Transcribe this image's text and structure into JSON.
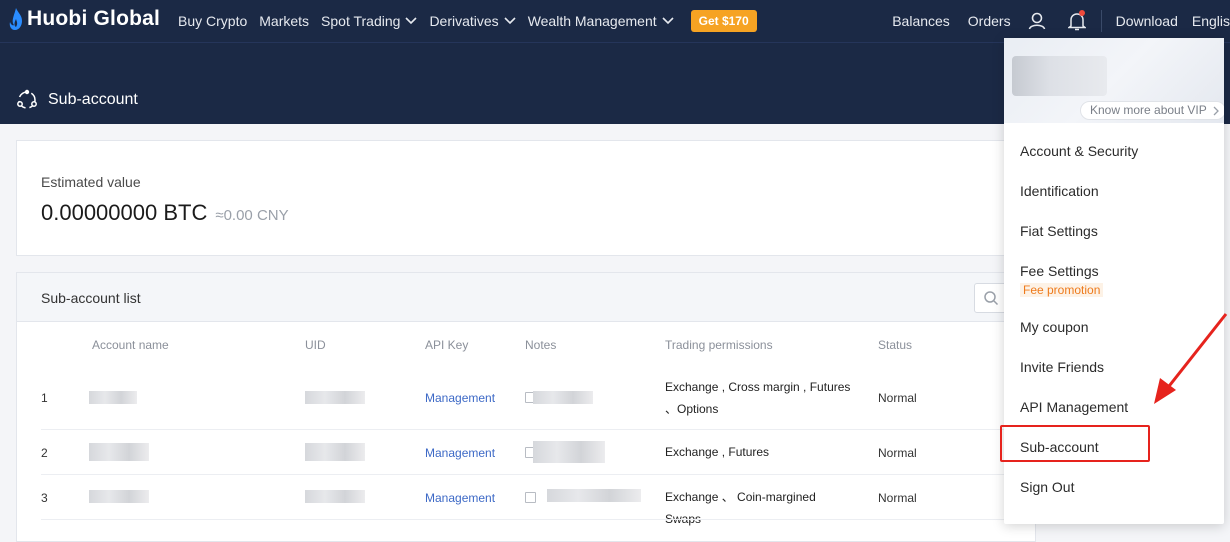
{
  "header": {
    "logo": "Huobi Global",
    "nav": [
      "Buy Crypto",
      "Markets",
      "Spot Trading",
      "Derivatives",
      "Wealth Management"
    ],
    "promo": "Get $170",
    "balances": "Balances",
    "orders": "Orders",
    "download": "Download",
    "language": "Englis"
  },
  "page": {
    "title": "Sub-account"
  },
  "estimate": {
    "label": "Estimated value",
    "value": "0.00000000 BTC",
    "approx": "≈0.00 CNY"
  },
  "list": {
    "title": "Sub-account list",
    "columns": {
      "account_name": "Account name",
      "uid": "UID",
      "api_key": "API Key",
      "notes": "Notes",
      "trading_permissions": "Trading permissions",
      "status": "Status"
    },
    "rows": [
      {
        "index": "1",
        "api_key": "Management",
        "permissions": "Exchange , Cross margin , Futures 、Options",
        "status": "Normal"
      },
      {
        "index": "2",
        "api_key": "Management",
        "permissions": "Exchange , Futures",
        "status": "Normal"
      },
      {
        "index": "3",
        "api_key": "Management",
        "permissions": "Exchange 、 Coin-margined Swaps",
        "status": "Normal"
      }
    ]
  },
  "dropdown": {
    "vip": "Know more about VIP",
    "items": [
      "Account & Security",
      "Identification",
      "Fiat Settings",
      "Fee Settings",
      "My coupon",
      "Invite Friends",
      "API Management",
      "Sub-account",
      "Sign Out"
    ],
    "fee_promotion": "Fee promotion"
  },
  "colors": {
    "header_bg": "#1b2945",
    "promo": "#f6a323",
    "link": "#3d69c6",
    "highlight": "#e6231d"
  }
}
